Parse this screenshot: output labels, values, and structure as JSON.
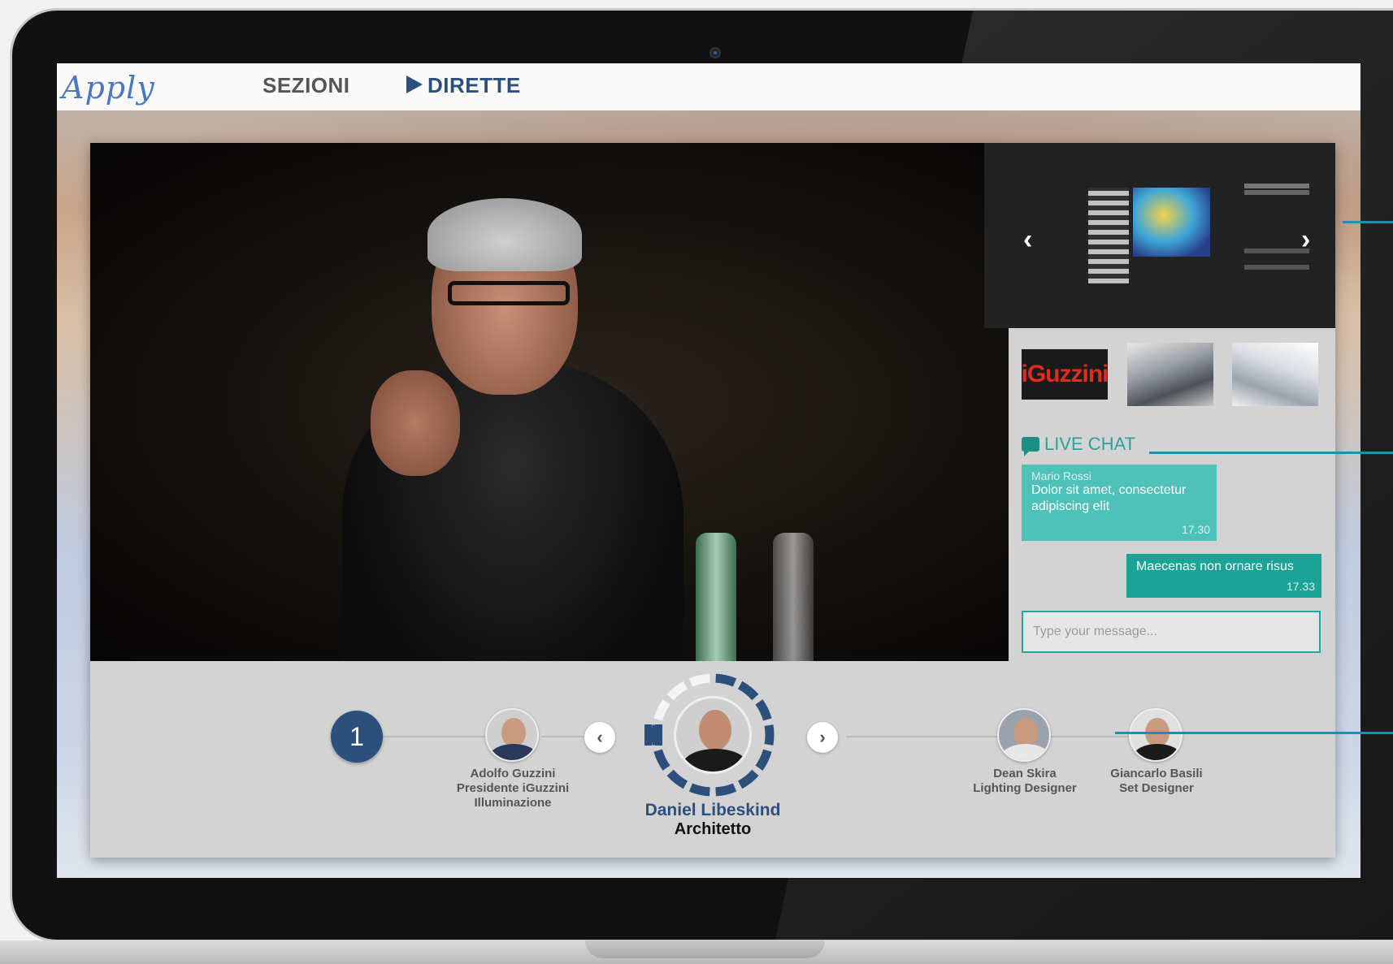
{
  "nav": {
    "logo": "Apply",
    "items": [
      "SEZIONI",
      "DIRETTE"
    ]
  },
  "sponsors": {
    "iguzzini": "iGuzzini"
  },
  "chat": {
    "title": "LIVE CHAT",
    "messages": [
      {
        "author": "Mario Rossi",
        "text": "Dolor sit amet, consectetur adipiscing elit",
        "time": "17.30"
      },
      {
        "author": "",
        "text": "Maecenas non ornare risus",
        "time": "17.33"
      }
    ],
    "input_placeholder": "Type your message..."
  },
  "timeline": {
    "step": "1",
    "speakers": [
      {
        "name": "Adolfo Guzzini",
        "role": "Presidente iGuzzini Illuminazione"
      },
      {
        "name": "Dean Skira",
        "role": "Lighting Designer"
      },
      {
        "name": "Giancarlo Basili",
        "role": "Set Designer"
      }
    ],
    "current": {
      "name": "Daniel Libeskind",
      "role": "Architetto",
      "progress": 0.78
    }
  },
  "colors": {
    "accent_blue": "#2c4f7c",
    "chat_teal": "#2aa39a",
    "msg_in": "#4ec2b8",
    "msg_out": "#1aa396",
    "callout": "#1d8fb3"
  }
}
